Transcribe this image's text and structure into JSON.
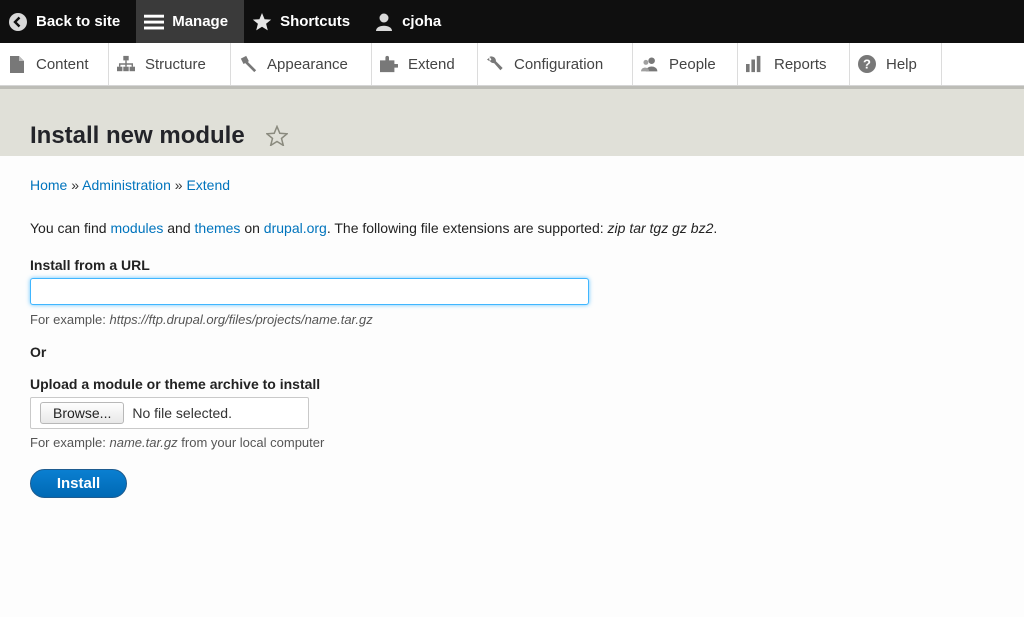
{
  "toolbar": {
    "back_label": "Back to site",
    "manage_label": "Manage",
    "shortcuts_label": "Shortcuts",
    "user_label": "cjoha"
  },
  "tray": {
    "items": [
      {
        "label": "Content",
        "icon": "page-icon"
      },
      {
        "label": "Structure",
        "icon": "structure-icon"
      },
      {
        "label": "Appearance",
        "icon": "brush-icon"
      },
      {
        "label": "Extend",
        "icon": "puzzle-icon"
      },
      {
        "label": "Configuration",
        "icon": "wrench-icon"
      },
      {
        "label": "People",
        "icon": "people-icon"
      },
      {
        "label": "Reports",
        "icon": "bar-chart-icon"
      },
      {
        "label": "Help",
        "icon": "help-icon"
      }
    ]
  },
  "page": {
    "title": "Install new module"
  },
  "breadcrumb": {
    "home": "Home",
    "sep": " » ",
    "administration": "Administration",
    "extend": "Extend"
  },
  "intro": {
    "t1": "You can find ",
    "modules": "modules",
    "t2": " and ",
    "themes": "themes",
    "t3": " on ",
    "drupal": "drupal.org",
    "t4": ". The following file extensions are supported: ",
    "extensions": "zip tar tgz gz bz2",
    "t5": "."
  },
  "url_field": {
    "label": "Install from a URL",
    "value": "",
    "desc_prefix": "For example: ",
    "desc_example": "https://ftp.drupal.org/files/projects/name.tar.gz"
  },
  "or_label": "Or",
  "upload": {
    "label": "Upload a module or theme archive to install",
    "browse_label": "Browse...",
    "file_status": "No file selected.",
    "desc_prefix": "For example: ",
    "desc_example": "name.tar.gz",
    "desc_suffix": " from your local computer"
  },
  "install_label": "Install",
  "colors": {
    "link": "#0074bd",
    "toolbar_bg": "#0f0f0f",
    "header_bg": "#e0e0d8",
    "button": "#0071b8"
  }
}
